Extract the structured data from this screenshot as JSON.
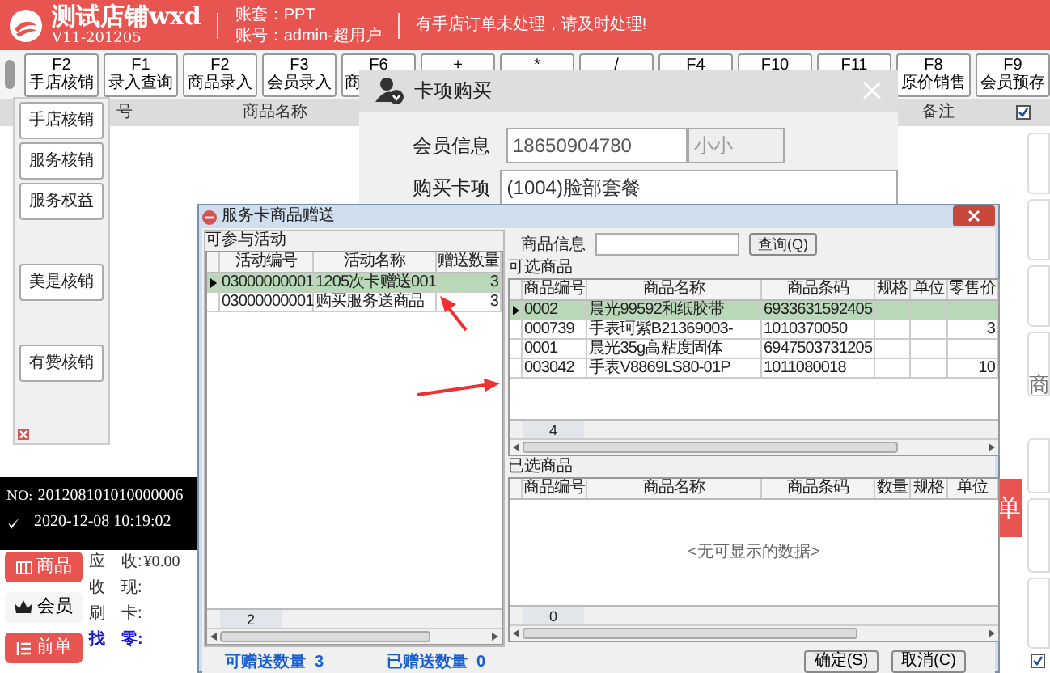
{
  "header": {
    "title": "测试店铺wxd",
    "version": "V11-201205",
    "account_set": "账套：PPT",
    "account": "账号：admin-超用户",
    "notice": "有手店订单未处理，请及时处理!"
  },
  "toolbar": {
    "buttons": [
      {
        "key": "F2",
        "label": "手店核销",
        "kind": "full"
      },
      {
        "key": "F1",
        "label": "录入查询",
        "kind": "full"
      },
      {
        "key": "F2",
        "label": "商品录入",
        "kind": "full"
      },
      {
        "key": "F3",
        "label": "会员录入",
        "kind": "full"
      },
      {
        "key": "F6",
        "label": "商",
        "kind": "clipped"
      },
      {
        "key": "+",
        "kind": "top"
      },
      {
        "key": "*",
        "kind": "top"
      },
      {
        "key": "/",
        "kind": "top"
      },
      {
        "key": "F4",
        "kind": "top"
      },
      {
        "key": "F10",
        "kind": "top"
      },
      {
        "key": "F11",
        "kind": "top"
      },
      {
        "key": "F8",
        "label": "原价销售",
        "kind": "full"
      },
      {
        "key": "F9",
        "label": "会员预存",
        "kind": "full"
      }
    ]
  },
  "table": {
    "columns": [
      "号",
      "商品名称",
      "备注"
    ]
  },
  "side_menu": {
    "groups": [
      [
        "手店核销",
        "服务核销",
        "服务权益"
      ],
      [
        "美是核销"
      ],
      [
        "有赞核销"
      ]
    ]
  },
  "right_panel": {
    "top_checkbox": {
      "checked": true
    },
    "card_text": "商",
    "bottom_checkbox": {
      "checked": true
    }
  },
  "order": {
    "no_label": "NO:",
    "number": "201208101010000006",
    "datetime": "2020-12-08 10:19:02"
  },
  "nav_buttons": [
    {
      "label": "商品",
      "kind": "primary"
    },
    {
      "label": "会员",
      "kind": "plain"
    },
    {
      "label": "前单",
      "kind": "primary"
    }
  ],
  "totals": [
    {
      "label": "应　收:",
      "value": "¥0.00",
      "kind": "normal"
    },
    {
      "label": "收　现:",
      "kind": "normal"
    },
    {
      "label": "刷　卡:",
      "kind": "normal"
    },
    {
      "label": "找　零:",
      "kind": "highlight"
    }
  ],
  "checkout_button": "单",
  "card_dialog": {
    "title": "卡项购买",
    "member_label": "会员信息",
    "member_phone": "18650904780",
    "member_name": "小小",
    "card_label": "购买卡项",
    "card_value": "(1004)脸部套餐"
  },
  "gift_dialog": {
    "title": "服务卡商品赠送",
    "activities": {
      "title": "可参与活动",
      "columns": [
        "活动编号",
        "活动名称",
        "赠送数量"
      ],
      "rows": [
        {
          "cells": [
            "03000000001",
            "1205次卡赠送001",
            "3"
          ],
          "selected": true
        },
        {
          "cells": [
            "03000000001",
            "购买服务送商品",
            "3"
          ],
          "selected": false
        }
      ],
      "count": "2"
    },
    "search_label": "商品信息",
    "search_button": "查询(Q)",
    "available": {
      "title": "可选商品",
      "columns": [
        "商品编号",
        "商品名称",
        "商品条码",
        "规格",
        "单位",
        "零售价"
      ],
      "rows": [
        {
          "cells": [
            "0002",
            "晨光99592和纸胶带",
            "6933631592405",
            "",
            "",
            ""
          ],
          "selected": true
        },
        {
          "cells": [
            "000739",
            "手表珂紫B21369003-",
            "1010370050",
            "",
            "",
            "3"
          ],
          "selected": false
        },
        {
          "cells": [
            "0001",
            "晨光35g高粘度固体",
            "6947503731205",
            "",
            "",
            ""
          ],
          "selected": false
        },
        {
          "cells": [
            "003042",
            "手表V8869LS80-01P",
            "1011080018",
            "",
            "",
            "10"
          ],
          "selected": false
        }
      ],
      "count": "4"
    },
    "chosen": {
      "title": "已选商品",
      "columns": [
        "商品编号",
        "商品名称",
        "商品条码",
        "数量",
        "规格",
        "单位"
      ],
      "empty_text": "<无可显示的数据>",
      "count": "0"
    },
    "giftable": "可赠送数量  3",
    "gifted": "已赠送数量  0",
    "ok_button": "确定(S)",
    "cancel_button": "取消(C)"
  }
}
